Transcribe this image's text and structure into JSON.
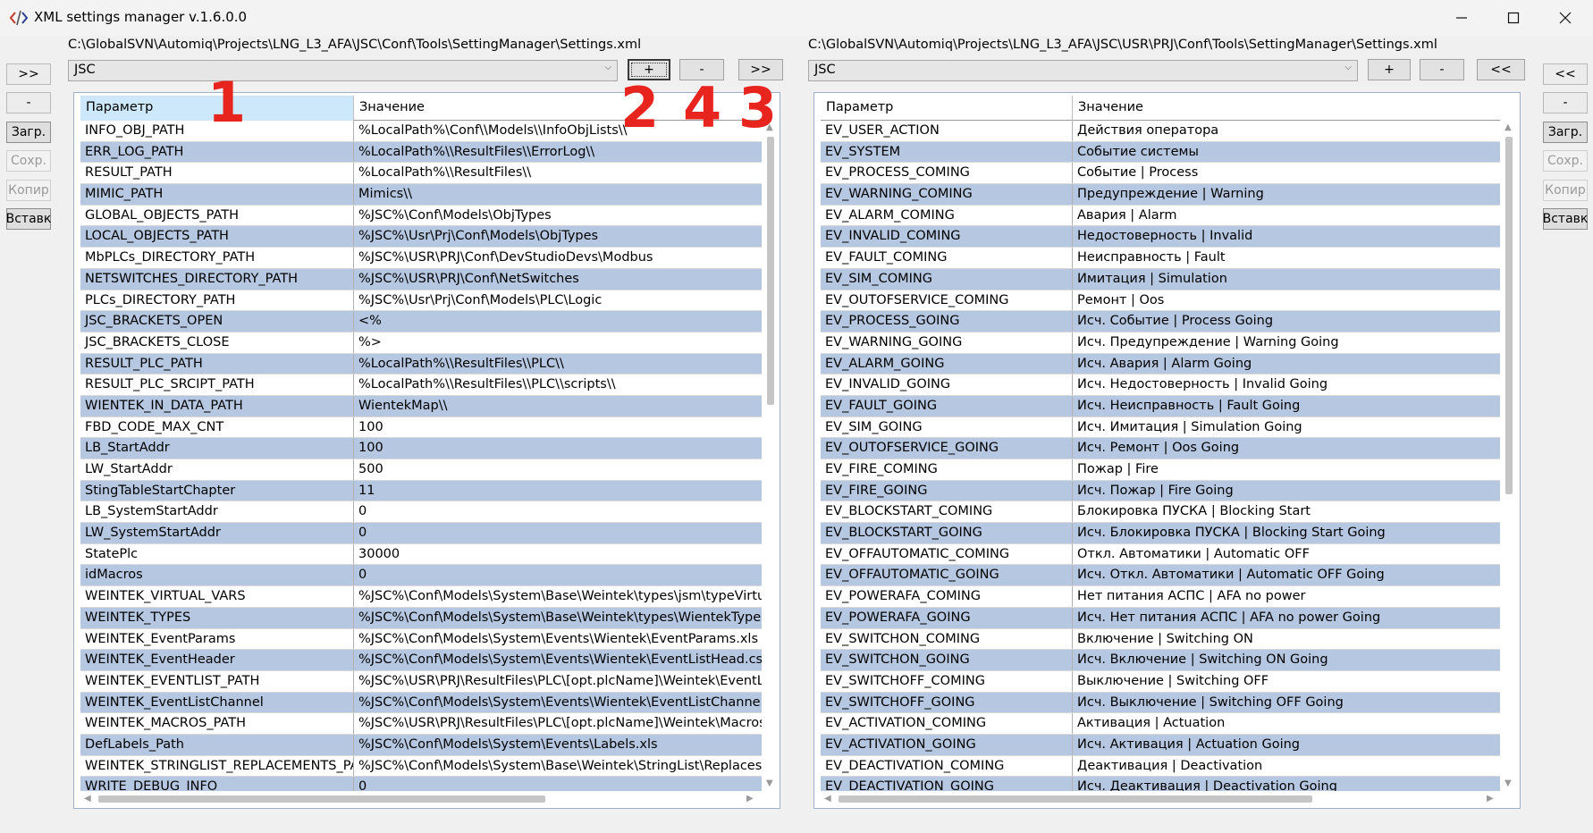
{
  "window": {
    "title": "XML settings manager v.1.6.0.0",
    "icons": {
      "app": "code-icon",
      "minimize": "minimize-icon",
      "maximize": "maximize-icon",
      "close": "close-icon"
    }
  },
  "left": {
    "path": "C:\\GlobalSVN\\Automiq\\Projects\\LNG_L3_AFA\\JSC\\Conf\\Tools\\SettingManager\\Settings.xml",
    "combo_value": "JSC",
    "buttons": {
      "add": "+",
      "remove": "-",
      "transfer": ">>"
    },
    "side_buttons": [
      ">>",
      "-",
      "Загр.",
      "Сохр.",
      "Копир",
      "Вставк"
    ],
    "headers": [
      "Параметр",
      "Значение"
    ],
    "rows": [
      [
        "INFO_OBJ_PATH",
        "%LocalPath%\\Conf\\\\Models\\\\InfoObjLists\\\\"
      ],
      [
        "ERR_LOG_PATH",
        "%LocalPath%\\\\ResultFiles\\\\ErrorLog\\\\"
      ],
      [
        "RESULT_PATH",
        "%LocalPath%\\\\ResultFiles\\\\"
      ],
      [
        "MIMIC_PATH",
        "Mimics\\\\"
      ],
      [
        "GLOBAL_OBJECTS_PATH",
        "%JSC%\\Conf\\Models\\ObjTypes"
      ],
      [
        "LOCAL_OBJECTS_PATH",
        "%JSC%\\Usr\\Prj\\Conf\\Models\\ObjTypes"
      ],
      [
        "MbPLCs_DIRECTORY_PATH",
        "%JSC%\\USR\\PRJ\\Conf\\DevStudioDevs\\Modbus"
      ],
      [
        "NETSWITCHES_DIRECTORY_PATH",
        "%JSC%\\USR\\PRJ\\Conf\\NetSwitches"
      ],
      [
        "PLCs_DIRECTORY_PATH",
        "%JSC%\\Usr\\Prj\\Conf\\Models\\PLC\\Logic"
      ],
      [
        "JSC_BRACKETS_OPEN",
        "<%"
      ],
      [
        "JSC_BRACKETS_CLOSE",
        "%>"
      ],
      [
        "RESULT_PLC_PATH",
        "%LocalPath%\\\\ResultFiles\\\\PLC\\\\"
      ],
      [
        "RESULT_PLC_SRCIPT_PATH",
        "%LocalPath%\\\\ResultFiles\\\\PLC\\\\scripts\\\\"
      ],
      [
        "WIENTEK_IN_DATA_PATH",
        "WientekMap\\\\"
      ],
      [
        "FBD_CODE_MAX_CNT",
        "100"
      ],
      [
        "LB_StartAddr",
        "100"
      ],
      [
        "LW_StartAddr",
        "500"
      ],
      [
        "StingTableStartChapter",
        "11"
      ],
      [
        "LB_SystemStartAddr",
        "0"
      ],
      [
        "LW_SystemStartAddr",
        "0"
      ],
      [
        "StatePlc",
        "30000"
      ],
      [
        "idMacros",
        "0"
      ],
      [
        "WEINTEK_VIRTUAL_VARS",
        "%JSC%\\Conf\\Models\\System\\Base\\Weintek\\types\\jsm\\typeVirtualVa"
      ],
      [
        "WEINTEK_TYPES",
        "%JSC%\\Conf\\Models\\System\\Base\\Weintek\\types\\WientekTypes.xls"
      ],
      [
        "WEINTEK_EventParams",
        "%JSC%\\Conf\\Models\\System\\Events\\Wientek\\EventParams.xls"
      ],
      [
        "WEINTEK_EventHeader",
        "%JSC%\\Conf\\Models\\System\\Events\\Wientek\\EventListHead.csv"
      ],
      [
        "WEINTEK_EVENTLIST_PATH",
        "%JSC%\\USR\\PRJ\\ResultFiles\\PLC\\[opt.plcName]\\Weintek\\EventList.xl"
      ],
      [
        "WEINTEK_EventListChannel",
        "%JSC%\\Conf\\Models\\System\\Events\\Wientek\\EventListChannel.csv"
      ],
      [
        "WEINTEK_MACROS_PATH",
        "%JSC%\\USR\\PRJ\\ResultFiles\\PLC\\[opt.plcName]\\Weintek\\Macroses"
      ],
      [
        "DefLabels_Path",
        "%JSC%\\Conf\\Models\\System\\Events\\Labels.xls"
      ],
      [
        "WEINTEK_STRINGLIST_REPLACEMENTS_PATH",
        "%JSC%\\Conf\\Models\\System\\Base\\Weintek\\StringList\\Replaces\\repl"
      ],
      [
        "WRITE_DEBUG_INFO",
        "0"
      ]
    ]
  },
  "right": {
    "path": "C:\\GlobalSVN\\Automiq\\Projects\\LNG_L3_AFA\\JSC\\USR\\PRJ\\Conf\\Tools\\SettingManager\\Settings.xml",
    "combo_value": "JSC",
    "buttons": {
      "add": "+",
      "remove": "-",
      "transfer": "<<"
    },
    "side_buttons": [
      "<<",
      "-",
      "Загр.",
      "Сохр.",
      "Копир",
      "Вставк"
    ],
    "headers": [
      "Параметр",
      "Значение"
    ],
    "rows": [
      [
        "EV_USER_ACTION",
        "Действия оператора"
      ],
      [
        "EV_SYSTEM",
        "Событие системы"
      ],
      [
        "EV_PROCESS_COMING",
        "Событие | Process"
      ],
      [
        "EV_WARNING_COMING",
        "Предупреждение | Warning"
      ],
      [
        "EV_ALARM_COMING",
        "Авария | Alarm"
      ],
      [
        "EV_INVALID_COMING",
        "Недостоверность | Invalid"
      ],
      [
        "EV_FAULT_COMING",
        "Неисправность | Fault"
      ],
      [
        "EV_SIM_COMING",
        "Имитация | Simulation"
      ],
      [
        "EV_OUTOFSERVICE_COMING",
        "Ремонт | Oos"
      ],
      [
        "EV_PROCESS_GOING",
        "Исч. Событие | Process Going"
      ],
      [
        "EV_WARNING_GOING",
        "Исч. Предупреждение | Warning Going"
      ],
      [
        "EV_ALARM_GOING",
        "Исч. Авария | Alarm Going"
      ],
      [
        "EV_INVALID_GOING",
        "Исч. Недостоверность | Invalid Going"
      ],
      [
        "EV_FAULT_GOING",
        "Исч. Неисправность | Fault Going"
      ],
      [
        "EV_SIM_GOING",
        "Исч. Имитация | Simulation Going"
      ],
      [
        "EV_OUTOFSERVICE_GOING",
        "Исч. Ремонт | Oos Going"
      ],
      [
        "EV_FIRE_COMING",
        "Пожар | Fire"
      ],
      [
        "EV_FIRE_GOING",
        "Исч. Пожар | Fire Going"
      ],
      [
        "EV_BLOCKSTART_COMING",
        "Блокировка ПУСКА | Blocking Start"
      ],
      [
        "EV_BLOCKSTART_GOING",
        "Исч. Блокировка ПУСКА | Blocking Start Going"
      ],
      [
        "EV_OFFAUTOMATIC_COMING",
        "Откл. Автоматики | Automatic OFF"
      ],
      [
        "EV_OFFAUTOMATIC_GOING",
        "Исч. Откл. Автоматики | Automatic OFF Going"
      ],
      [
        "EV_POWERAFA_COMING",
        "Нет питания АСПС | AFA no power"
      ],
      [
        "EV_POWERAFA_GOING",
        "Исч. Нет питания АСПС | AFA no power Going"
      ],
      [
        "EV_SWITCHON_COMING",
        "Включение | Switching ON"
      ],
      [
        "EV_SWITCHON_GOING",
        "Исч. Включение | Switching ON Going"
      ],
      [
        "EV_SWITCHOFF_COMING",
        "Выключение | Switching OFF"
      ],
      [
        "EV_SWITCHOFF_GOING",
        "Исч. Выключение | Switching OFF Going"
      ],
      [
        "EV_ACTIVATION_COMING",
        "Активация | Actuation"
      ],
      [
        "EV_ACTIVATION_GOING",
        "Исч. Активация | Actuation Going"
      ],
      [
        "EV_DEACTIVATION_COMING",
        "Деактивация | Deactivation"
      ],
      [
        "EV_DEACTIVATION_GOING",
        "Исч. Деактивация | Deactivation Going"
      ]
    ]
  },
  "annotations": [
    "1",
    "2",
    "4",
    "3"
  ]
}
